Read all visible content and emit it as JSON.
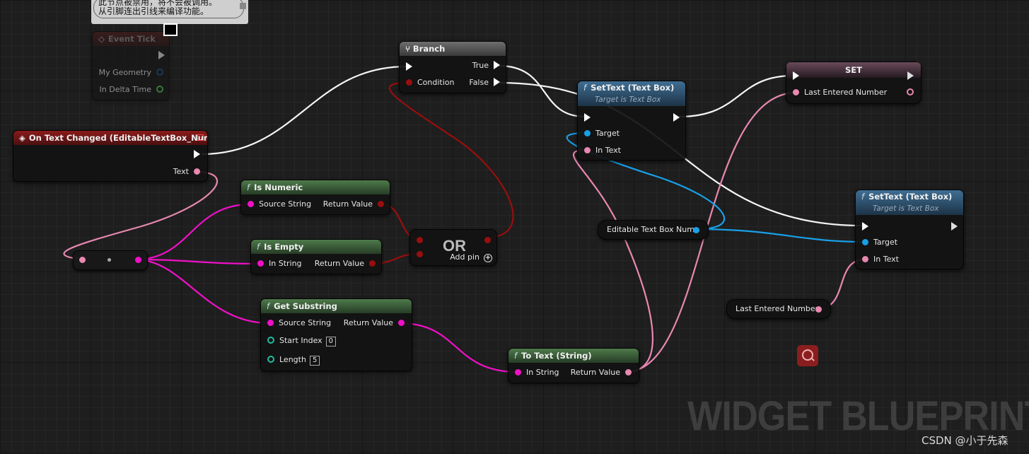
{
  "tooltip": {
    "line1": "此节点被禁用，将不会被调用。",
    "line2": "从引脚连出引线来编译功能。"
  },
  "nodes": {
    "event_tick": {
      "title": "Event Tick",
      "pins": [
        "My Geometry",
        "In Delta Time"
      ]
    },
    "on_text_changed": {
      "title": "On Text Changed (EditableTextBox_Num)",
      "pin_text": "Text"
    },
    "branch": {
      "title": "Branch",
      "condition": "Condition",
      "true_label": "True",
      "false_label": "False"
    },
    "is_numeric": {
      "title": "Is Numeric",
      "input": "Source String",
      "output": "Return Value"
    },
    "is_empty": {
      "title": "Is Empty",
      "input": "In String",
      "output": "Return Value"
    },
    "or_node": {
      "title": "OR",
      "add_pin": "Add pin"
    },
    "get_substring": {
      "title": "Get Substring",
      "input": "Source String",
      "output": "Return Value",
      "start_index_label": "Start Index",
      "start_index_value": "0",
      "length_label": "Length",
      "length_value": "5"
    },
    "to_text": {
      "title": "To Text (String)",
      "input": "In String",
      "output": "Return Value"
    },
    "settext_1": {
      "title": "SetText (Text Box)",
      "subtitle": "Target is Text Box",
      "target": "Target",
      "in_text": "In Text"
    },
    "set_node": {
      "title": "SET",
      "var": "Last Entered Number"
    },
    "settext_2": {
      "title": "SetText (Text Box)",
      "subtitle": "Target is Text Box",
      "target": "Target",
      "in_text": "In Text"
    },
    "editable_var": {
      "label": "Editable Text Box Num"
    },
    "last_var": {
      "label": "Last Entered Number"
    }
  },
  "watermark": "WIDGET BLUEPRINT",
  "credit": "CSDN @小于先森",
  "colors": {
    "exec": "#ffffff",
    "string": "#f010c8",
    "text": "#e888b0",
    "bool": "#9a0e0e",
    "object": "#18a0e8",
    "int": "#1ebea0",
    "event_header": "#8b1b1b",
    "function_header": "#4e7a4a",
    "target_function_header": "#3f6e93"
  },
  "icons": [
    "event-icon",
    "function-icon",
    "branch-icon",
    "search-icon",
    "add-pin-icon",
    "monitor-icon"
  ]
}
